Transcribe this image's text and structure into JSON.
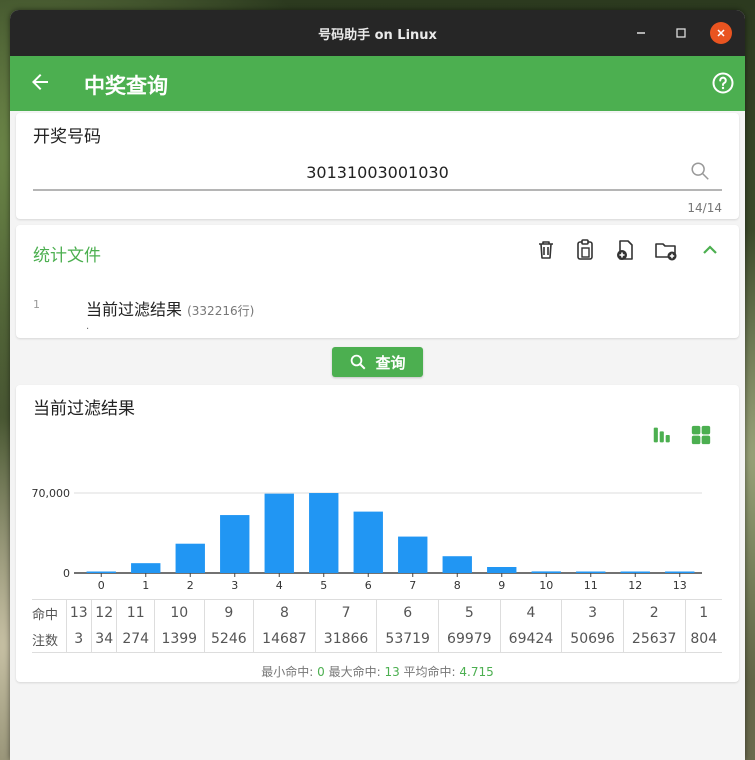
{
  "window": {
    "title": "号码助手 on Linux"
  },
  "appbar": {
    "title": "中奖查询"
  },
  "number_card": {
    "label": "开奖号码",
    "value": "30131003001030",
    "counter": "14/14"
  },
  "stats_file": {
    "title": "统计文件",
    "rows": [
      {
        "index": "1",
        "name": "当前过滤结果",
        "count": "(332216行)",
        "note": "."
      }
    ]
  },
  "query_button": {
    "label": "查询"
  },
  "result": {
    "title": "当前过滤结果",
    "hit_label": "命中",
    "count_label": "注数",
    "hits": [
      "13",
      "12",
      "11",
      "10",
      "9",
      "8",
      "7",
      "6",
      "5",
      "4",
      "3",
      "2",
      "1"
    ],
    "counts": [
      "3",
      "34",
      "274",
      "1399",
      "5246",
      "14687",
      "31866",
      "53719",
      "69979",
      "69424",
      "50696",
      "25637",
      "804"
    ],
    "summary": {
      "min_label": "最小命中:",
      "min": "0",
      "max_label": "最大命中:",
      "max": "13",
      "avg_label": "平均命中:",
      "avg": "4.715"
    }
  },
  "colors": {
    "accent": "#4caf50",
    "bar": "#2196f3"
  },
  "chart_data": {
    "type": "bar",
    "categories": [
      "0",
      "1",
      "2",
      "3",
      "4",
      "5",
      "6",
      "7",
      "8",
      "9",
      "10",
      "11",
      "12",
      "13"
    ],
    "values": [
      804,
      8600,
      25637,
      50696,
      69424,
      69979,
      53719,
      31866,
      14687,
      5246,
      1399,
      274,
      34,
      3
    ],
    "yticks": [
      "0",
      "70,000"
    ],
    "ylim": [
      0,
      70000
    ],
    "grid": true
  }
}
